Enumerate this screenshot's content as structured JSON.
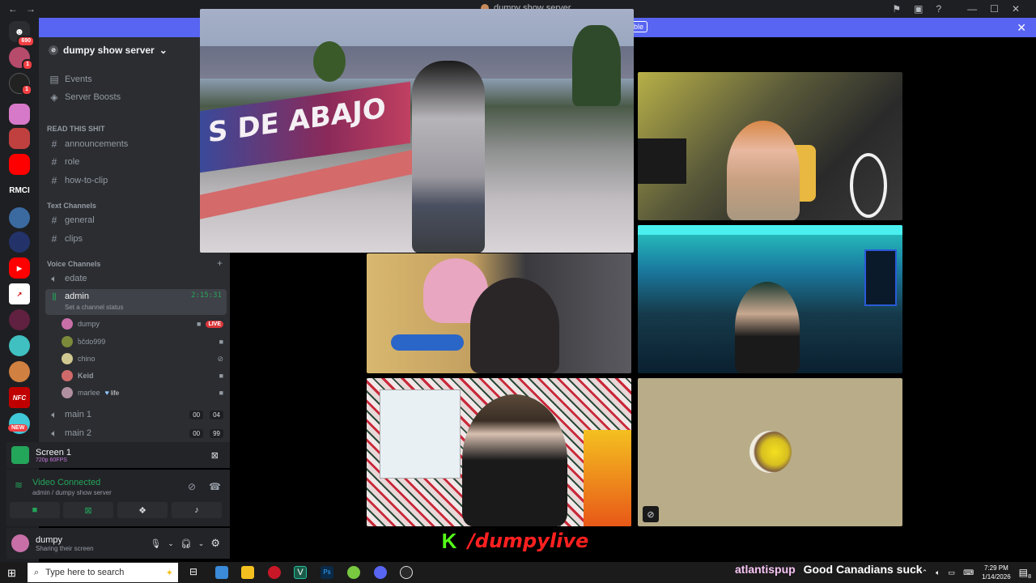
{
  "titlebar": {
    "title": "dumpy show server",
    "back": "←",
    "forward": "→"
  },
  "rail": {
    "top_badge": "690",
    "badges": [
      "1",
      "1"
    ],
    "labels": {
      "rmci": "RMCI",
      "new": "NEW"
    }
  },
  "banner": {
    "button_label": "ble"
  },
  "sidebar": {
    "server_name": "dumpy show server",
    "items": [
      {
        "label": "Events",
        "icon": "calendar-icon"
      },
      {
        "label": "Server Boosts",
        "icon": "boost-icon"
      }
    ],
    "categories": {
      "read": "READ THIS SHIT",
      "text": "Text Channels",
      "voice": "Voice Channels"
    },
    "read_channels": [
      "announcements",
      "role",
      "how-to-clip"
    ],
    "text_channels": [
      "general",
      "clips"
    ],
    "voice_channels": {
      "edate": "edate",
      "admin": "admin",
      "admin_time": "2:15:31",
      "admin_status": "Set a channel status",
      "main1": "main 1",
      "main1_count": "00",
      "main1_limit": "04",
      "main2": "main 2",
      "main2_count": "00",
      "main2_limit": "99"
    },
    "voice_users": [
      {
        "name": "dumpy",
        "live": "LIVE"
      },
      {
        "name": "ხčdo999"
      },
      {
        "name": "chino"
      },
      {
        "name": "Keid"
      },
      {
        "name": "marlee",
        "tag": "life"
      }
    ]
  },
  "screen_panel": {
    "title": "Screen 1",
    "sub": "720p 60FPS"
  },
  "voice_panel": {
    "status": "Video Connected",
    "sub": "admin / dumpy show server"
  },
  "user_panel": {
    "name": "dumpy",
    "status": "Sharing their screen"
  },
  "stream": {
    "wall_text": "S DE ABAJO",
    "brand_letter": "K",
    "handle": "/dumpylive"
  },
  "chat": {
    "user": "atlantispup",
    "message": "Good Canadians suck"
  },
  "taskbar": {
    "search_placeholder": "Type here to search",
    "time": "7:29 PM",
    "date": "1/14/2026",
    "notif_count": "8"
  },
  "colors": {
    "accent": "#5865f2",
    "online": "#23a55a",
    "live": "#da373c"
  }
}
